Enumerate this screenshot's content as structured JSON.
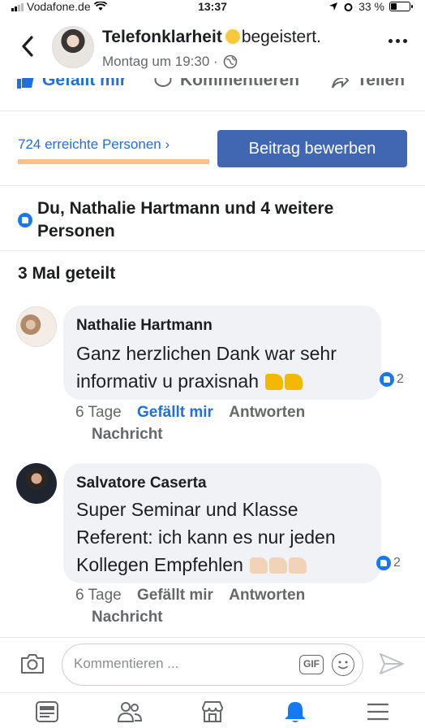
{
  "status_bar": {
    "carrier": "Vodafone.de",
    "time": "13:37",
    "battery_text": "33 %",
    "battery_level": 0.33
  },
  "header": {
    "page_name": "Telefonklarheit",
    "feeling": "begeistert.",
    "timestamp": "Montag um 19:30 ·",
    "icons": [
      "back-chevron-icon",
      "globe-icon",
      "more-icon"
    ]
  },
  "post_actions": {
    "like_label": "Gefällt mir",
    "comment_label": "Kommentieren",
    "share_label": "Teilen"
  },
  "insights": {
    "reach_text": "724 erreichte Personen",
    "promote_label": "Beitrag bewerben"
  },
  "reactions_summary": "Du, Nathalie Hartmann und 4 weitere Personen",
  "shares_text": "3 Mal geteilt",
  "comments": [
    {
      "author": "Nathalie Hartmann",
      "text": "Ganz herzlichen Dank war sehr informativ u praxisnah",
      "reaction_count": "2",
      "age": "6 Tage",
      "like_label": "Gefällt mir",
      "liked": true,
      "reply_label": "Antworten",
      "message_label": "Nachricht"
    },
    {
      "author": "Salvatore Caserta",
      "text": "Super Seminar und Klasse Referent: ich kann es nur jeden Kollegen Empfehlen",
      "reaction_count": "2",
      "age": "6 Tage",
      "like_label": "Gefällt mir",
      "liked": false,
      "reply_label": "Antworten",
      "message_label": "Nachricht"
    }
  ],
  "composer": {
    "placeholder": "Kommentieren ...",
    "gif_label": "GIF"
  },
  "tab_bar": {
    "tabs": [
      "news-feed-icon",
      "friends-icon",
      "marketplace-icon",
      "notifications-icon",
      "menu-icon"
    ],
    "active": "notifications-icon"
  },
  "colors": {
    "accent": "#216fdb",
    "promote_button": "#4267b2",
    "reach_underline": "#f6c08a",
    "bubble": "#f0f2f5"
  }
}
